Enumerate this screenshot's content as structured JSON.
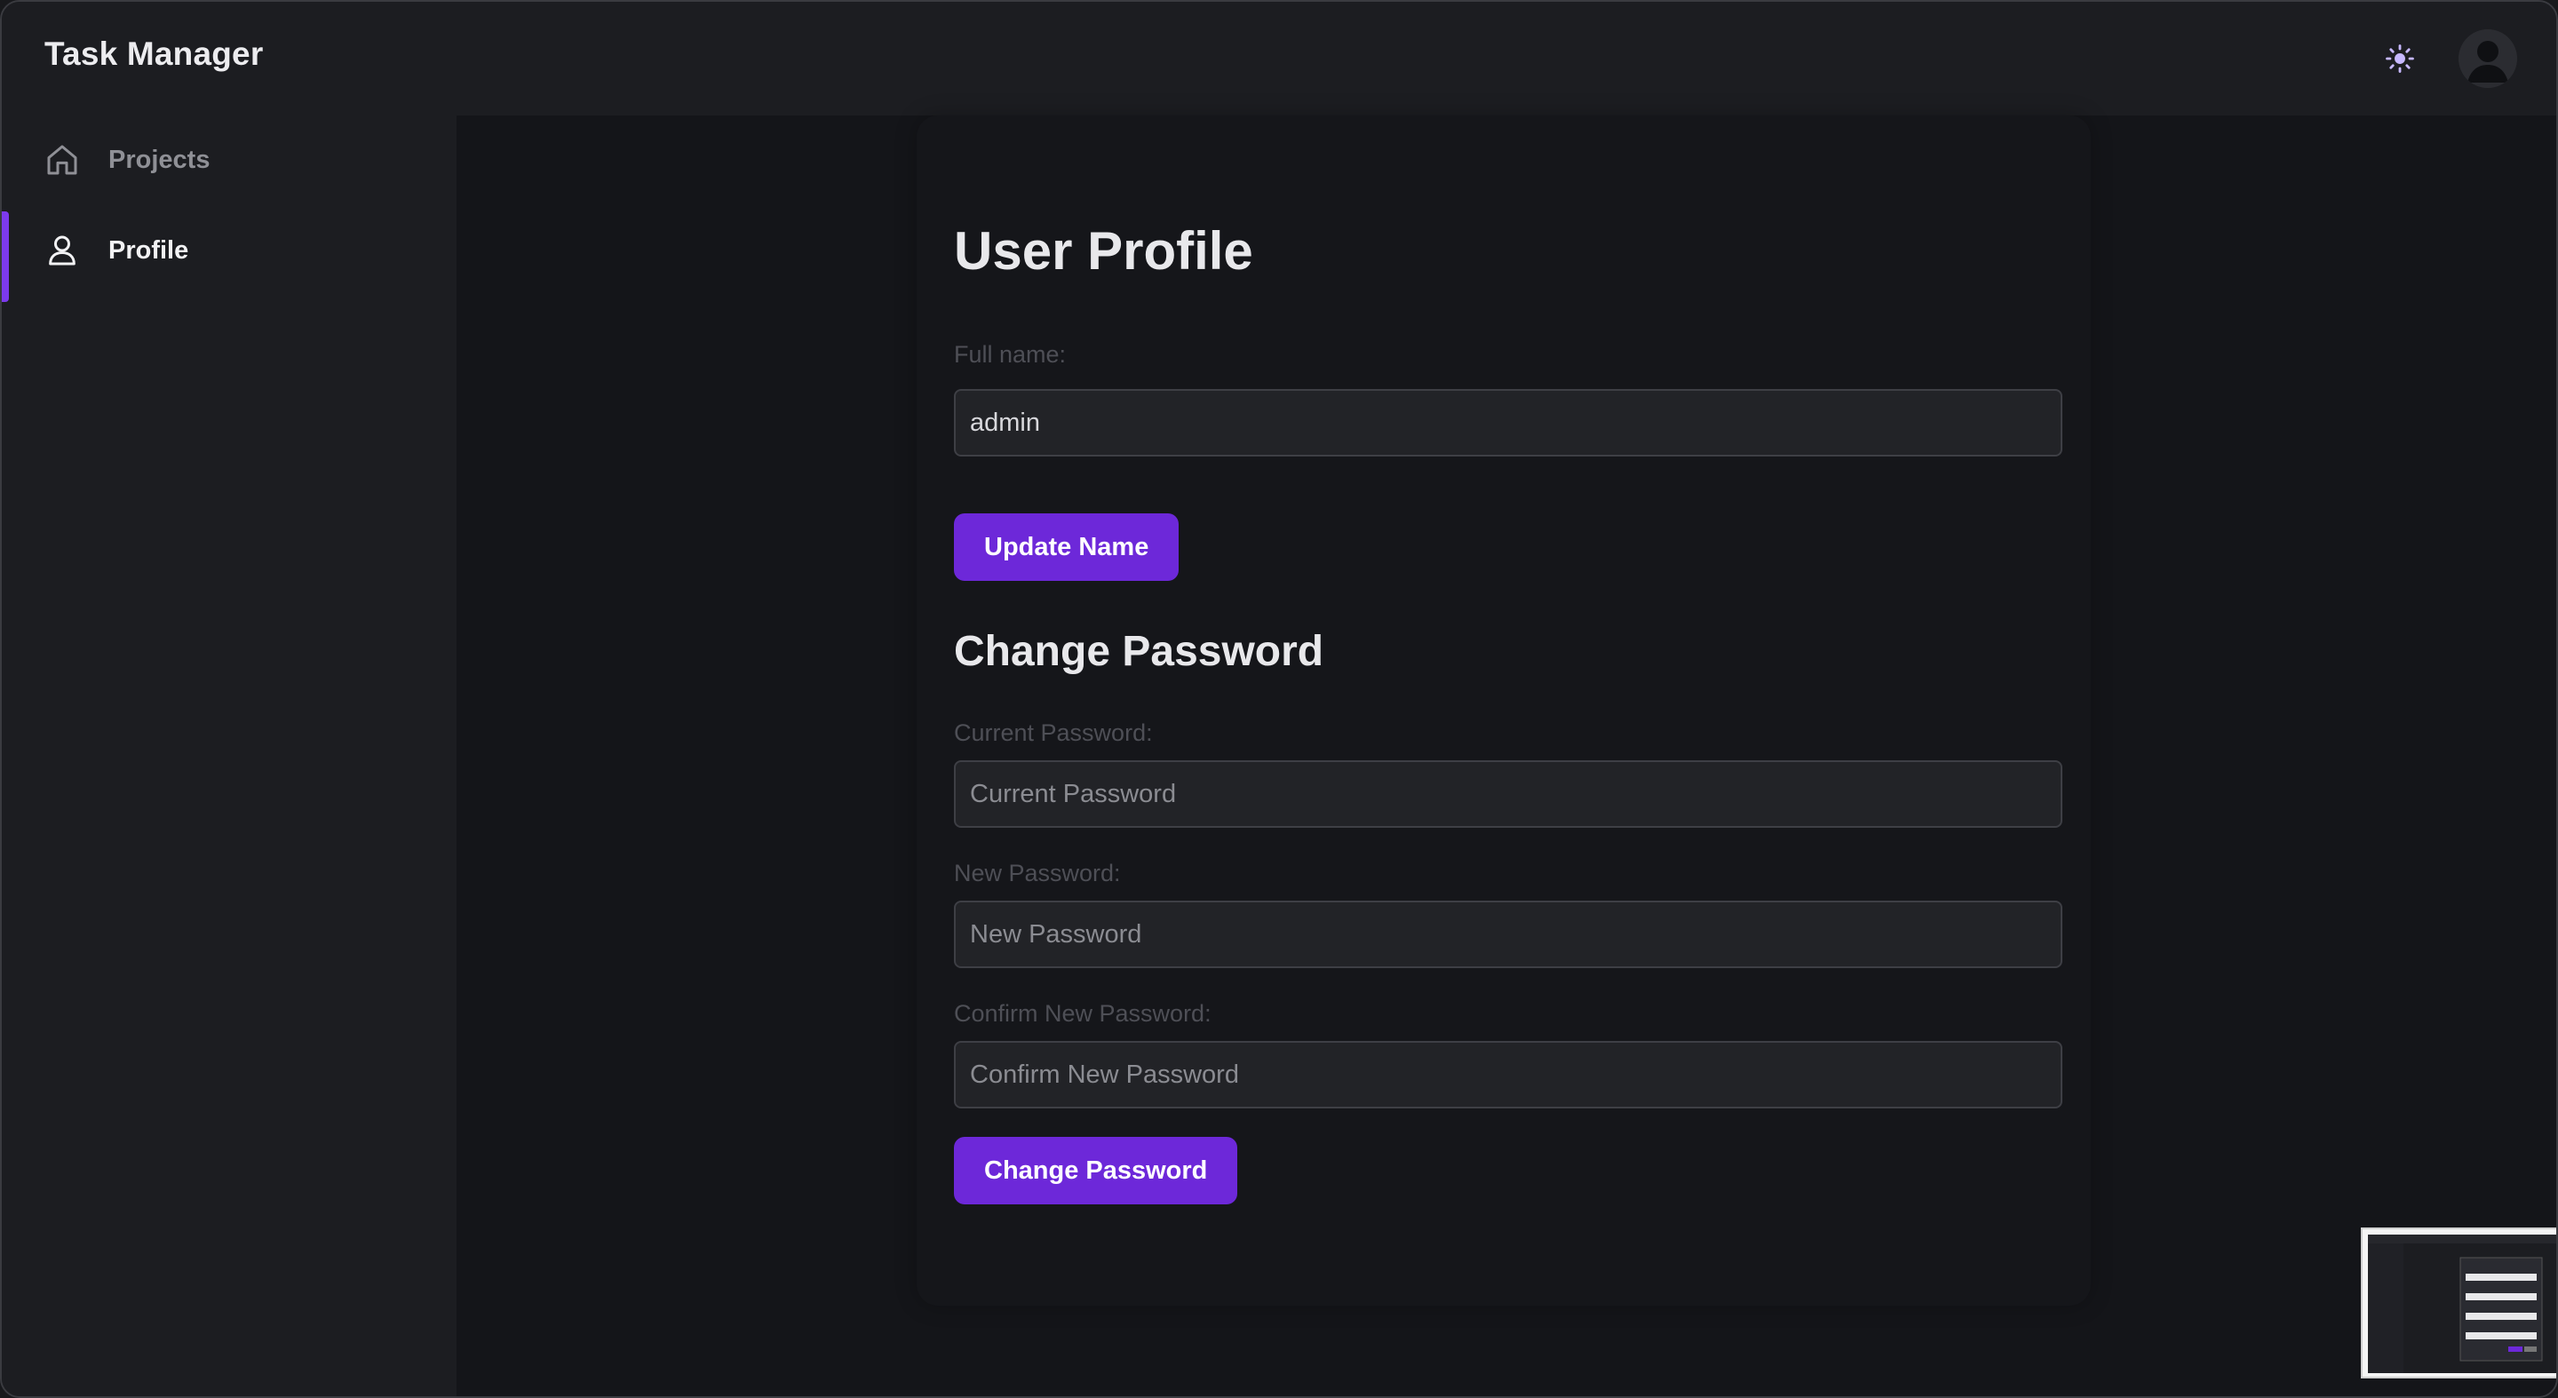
{
  "header": {
    "app_title": "Task Manager",
    "theme_icon": "sun-icon",
    "avatar_icon": "user-avatar-icon"
  },
  "sidebar": {
    "items": [
      {
        "label": "Projects",
        "icon": "home-icon",
        "active": false
      },
      {
        "label": "Profile",
        "icon": "user-icon",
        "active": true
      }
    ]
  },
  "profile": {
    "title": "User Profile",
    "full_name_label": "Full name:",
    "full_name_value": "admin",
    "update_button": "Update Name"
  },
  "password": {
    "title": "Change Password",
    "current_label": "Current Password:",
    "current_placeholder": "Current Password",
    "new_label": "New Password:",
    "new_placeholder": "New Password",
    "confirm_label": "Confirm New Password:",
    "confirm_placeholder": "Confirm New Password",
    "change_button": "Change Password"
  },
  "colors": {
    "accent": "#6d28d9",
    "active_indicator": "#7c3aed",
    "background": "#141519",
    "sidebar": "#1c1d21"
  }
}
